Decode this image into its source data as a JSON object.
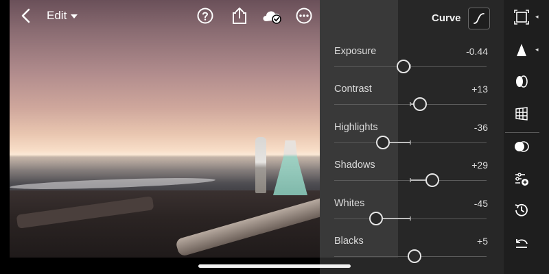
{
  "header": {
    "back_icon": "chevron-left-icon",
    "edit_label": "Edit",
    "icons": [
      "help-icon",
      "share-icon",
      "cloud-synced-icon",
      "more-icon"
    ]
  },
  "panel": {
    "title": "Curve",
    "curve_icon": "curve-icon",
    "sliders": [
      {
        "label": "Exposure",
        "value": "-0.44",
        "level": -0.44
      },
      {
        "label": "Contrast",
        "value": "+13",
        "level": 13
      },
      {
        "label": "Highlights",
        "value": "-36",
        "level": -36
      },
      {
        "label": "Shadows",
        "value": "+29",
        "level": 29
      },
      {
        "label": "Whites",
        "value": "-45",
        "level": -45
      },
      {
        "label": "Blacks",
        "value": "+5",
        "level": 5
      }
    ]
  },
  "toolbar": {
    "tools": [
      "crop-icon",
      "selective-icon",
      "healing-icon",
      "geometry-icon",
      "light-icon",
      "presets-icon",
      "history-icon",
      "undo-icon"
    ],
    "active_tool": "light-icon"
  },
  "colors": {
    "panel_bg": "#272727",
    "toolbar_bg": "#1e1e1e",
    "text": "#dcdcdc"
  }
}
